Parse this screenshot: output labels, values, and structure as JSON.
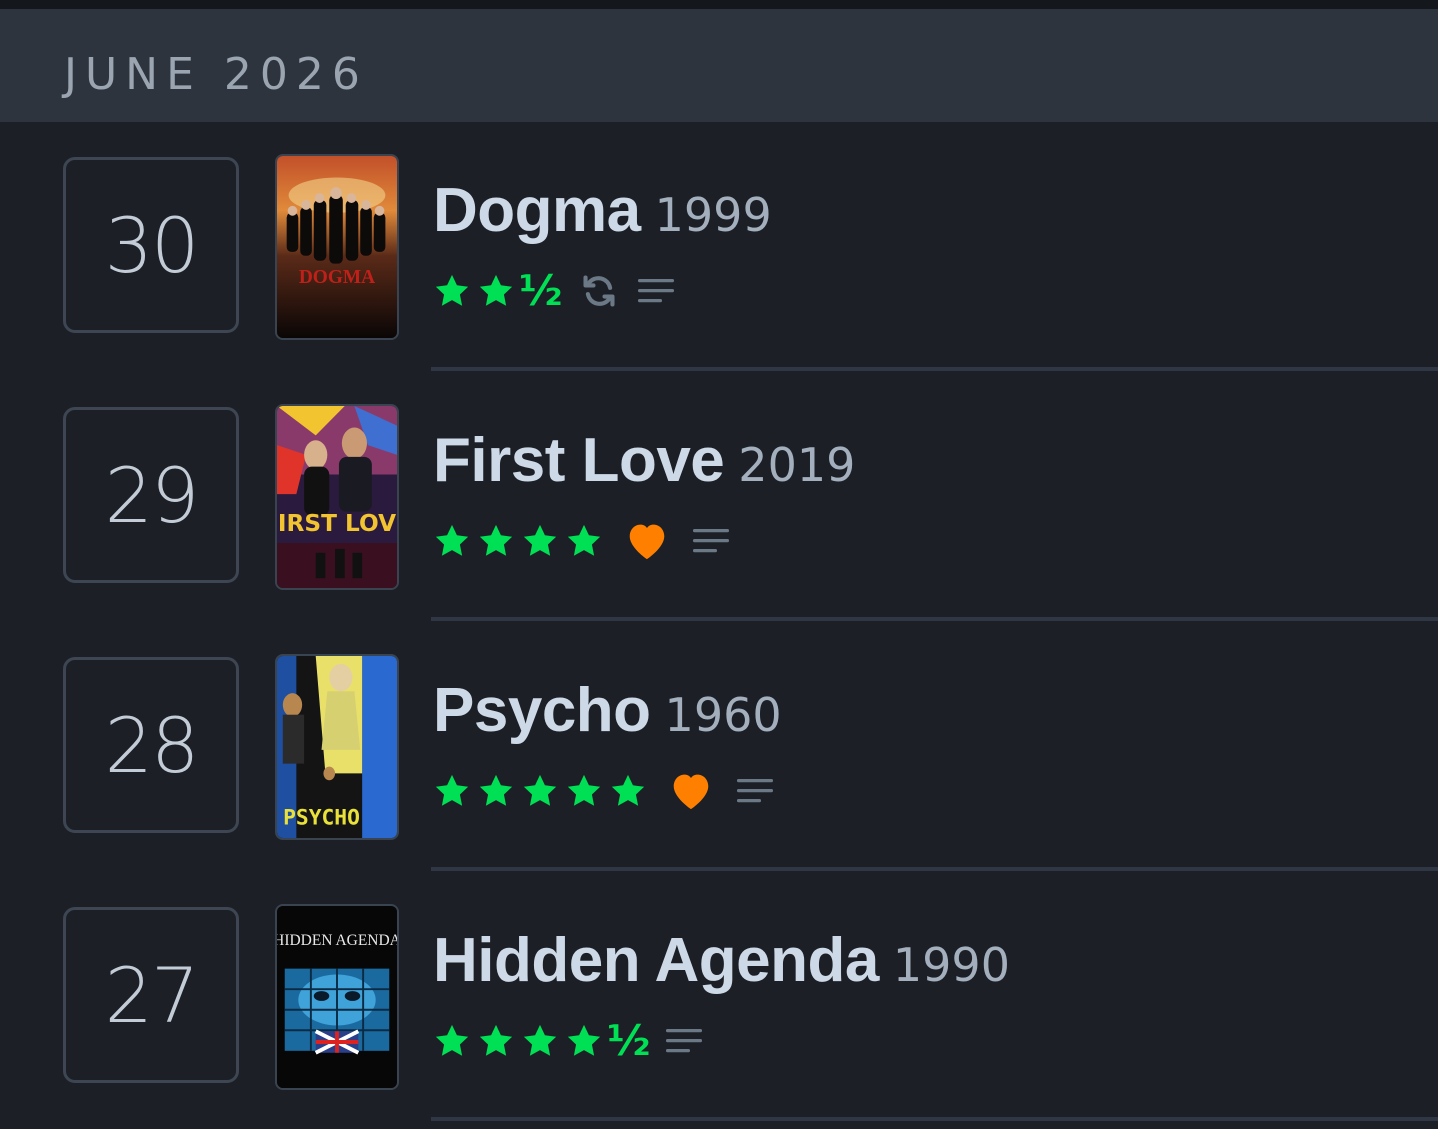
{
  "month_header": "JUNE 2026",
  "colors": {
    "star": "#00e054",
    "heart": "#ff8000",
    "muted_icon": "#6b7886"
  },
  "entries": [
    {
      "day": "30",
      "title": "Dogma",
      "year": "1999",
      "rating_stars": 2.5,
      "full_stars": 2,
      "half_star_glyph": "½",
      "liked": false,
      "rewatch": true,
      "has_review": true,
      "poster_text": "DOGMA"
    },
    {
      "day": "29",
      "title": "First Love",
      "year": "2019",
      "rating_stars": 4,
      "full_stars": 4,
      "half_star_glyph": "",
      "liked": true,
      "rewatch": false,
      "has_review": true,
      "poster_text": "FIRST LOVE"
    },
    {
      "day": "28",
      "title": "Psycho",
      "year": "1960",
      "rating_stars": 5,
      "full_stars": 5,
      "half_star_glyph": "",
      "liked": true,
      "rewatch": false,
      "has_review": true,
      "poster_text": "PSYCHO"
    },
    {
      "day": "27",
      "title": "Hidden Agenda",
      "year": "1990",
      "rating_stars": 4.5,
      "full_stars": 4,
      "half_star_glyph": "½",
      "liked": false,
      "rewatch": false,
      "has_review": true,
      "poster_text": "HIDDEN AGENDA"
    }
  ]
}
